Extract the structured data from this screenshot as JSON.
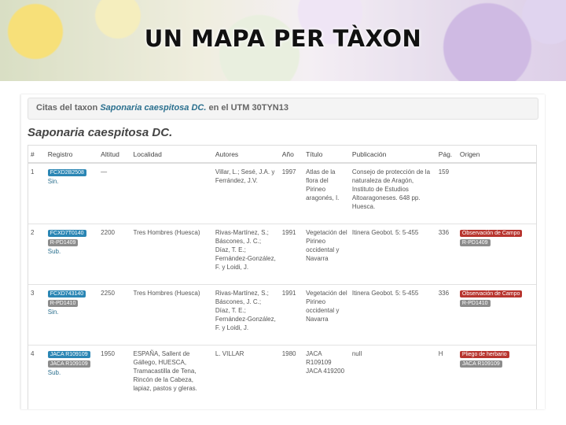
{
  "slide": {
    "title": "UN MAPA PER TÀXON"
  },
  "breadcrumb": {
    "prefix": "Citas del taxon",
    "taxon": "Saponaria caespitosa DC.",
    "middle": "en el UTM",
    "utm": "30TYN13"
  },
  "heading": "Saponaria caespitosa DC.",
  "table": {
    "columns": [
      "#",
      "Registro",
      "Altitud",
      "Localidad",
      "Autores",
      "Año",
      "Título",
      "Publicación",
      "Pág.",
      "Origen"
    ],
    "rows": [
      {
        "num": "1",
        "badges": [
          "FCXD2B2508"
        ],
        "detail": "Sin.",
        "altitud": "—",
        "localidad": "",
        "autores": "Villar, L.; Sesé, J.A. y Ferrández, J.V.",
        "anio": "1997",
        "titulo": "Atlas de la flora del Pirineo aragonés, I.",
        "publicacion": "Consejo de protección de la naturaleza de Aragón, Instituto de Estudios Altoaragoneses. 648 pp. Huesca.",
        "pag": "159",
        "origen": []
      },
      {
        "num": "2",
        "badges": [
          "FCXD7T0140",
          "R-PD1409"
        ],
        "detail": "Sub.",
        "altitud": "2200",
        "localidad": "Tres Hombres (Huesca)",
        "autores": "Rivas-Martínez, S.; Báscones, J. C.; Díaz, T. E.; Fernández-González, F. y Loidi, J.",
        "anio": "1991",
        "titulo": "Vegetación del Pirineo occidental y Navarra",
        "publicacion": "Itinera Geobot. 5: 5-455",
        "pag": "336",
        "origen": [
          {
            "label": "Observación de Campo",
            "color": "red"
          },
          {
            "label": "R-PD1409",
            "color": "gray"
          }
        ]
      },
      {
        "num": "3",
        "badges": [
          "FCXD743140",
          "R-PD1410"
        ],
        "detail": "Sin.",
        "altitud": "2250",
        "localidad": "Tres Hombres (Huesca)",
        "autores": "Rivas-Martínez, S.; Báscones, J. C.; Díaz, T. E.; Fernández-González, F. y Loidi, J.",
        "anio": "1991",
        "titulo": "Vegetación del Pirineo occidental y Navarra",
        "publicacion": "Itinera Geobot. 5: 5-455",
        "pag": "336",
        "origen": [
          {
            "label": "Observación de Campo",
            "color": "red"
          },
          {
            "label": "R-PD1410",
            "color": "gray"
          }
        ]
      },
      {
        "num": "4",
        "badges": [
          "JACA R109109",
          "JACA R109109"
        ],
        "detail": "Sub.",
        "altitud": "1950",
        "localidad": "ESPAÑA, Sallent de Gállego, HUESCA, Tramacastilla de Tena, Rincón de la Cabeza, lapiaz, pastos y gleras.",
        "autores": "L. VILLAR",
        "anio": "1980",
        "titulo": "JACA R109109 JACA 419200",
        "publicacion": "null",
        "pag": "H",
        "origen": [
          {
            "label": "Pliego de herbario",
            "color": "red"
          },
          {
            "label": "JACA R109109",
            "color": "gray"
          }
        ]
      }
    ]
  }
}
